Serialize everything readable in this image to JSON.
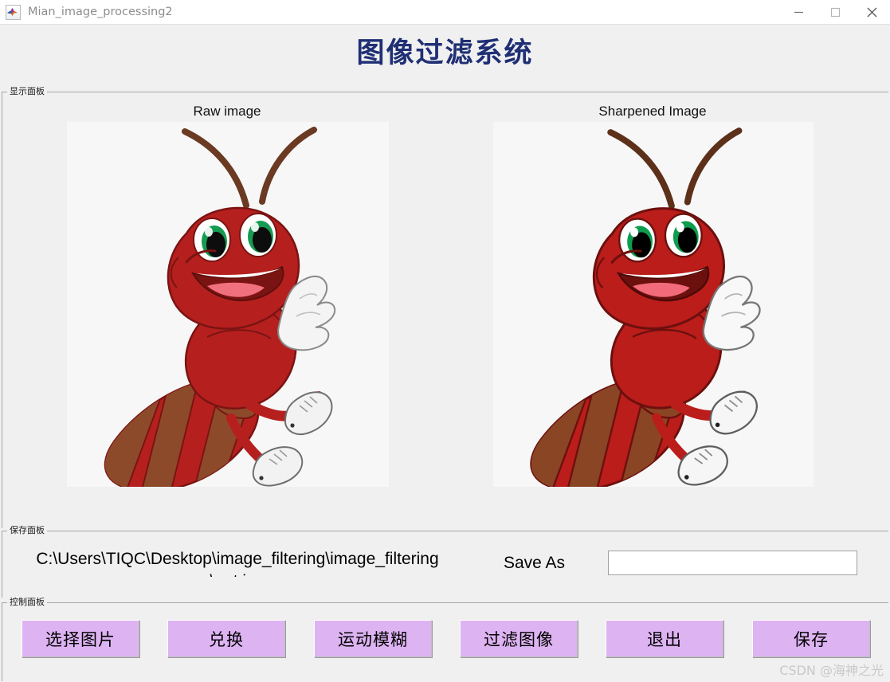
{
  "window": {
    "title": "Mian_image_processing2",
    "icon": "matlab-icon",
    "minimize": "—",
    "maximize": "□",
    "close": "✕"
  },
  "heading": "图像过滤系统",
  "display_panel": {
    "label": "显示面板",
    "axes": [
      {
        "title": "Raw image",
        "name": "raw-image"
      },
      {
        "title": "Sharpened Image",
        "name": "sharpened-image"
      }
    ]
  },
  "save_panel": {
    "label": "保存面板",
    "path": "C:\\Users\\TIQC\\Desktop\\image_filtering\\image_filtering\n\\ant.jpg",
    "save_as_label": "Save As",
    "save_as_value": "",
    "save_as_placeholder": ""
  },
  "control_panel": {
    "label": "控制面板",
    "buttons": [
      {
        "label": "选择图片",
        "name": "select-image-button"
      },
      {
        "label": "兑换",
        "name": "exchange-button"
      },
      {
        "label": "运动模糊",
        "name": "motion-blur-button"
      },
      {
        "label": "过滤图像",
        "name": "filter-image-button"
      },
      {
        "label": "退出",
        "name": "exit-button"
      },
      {
        "label": "保存",
        "name": "save-button"
      }
    ]
  },
  "watermark": "CSDN @海神之光",
  "colors": {
    "window_background": "#f0f0f0",
    "title_text": "#1f2f74",
    "button_face": "#ddb3f2",
    "panel_border": "#a6a6a6",
    "image_canvas": "#f7f7f7",
    "ant_body_red": "#b5201e",
    "ant_abdomen_brown": "#8d4a2a",
    "ant_antenna_brown": "#6b3a22",
    "ant_eye_green": "#159b52",
    "ant_tongue_pink": "#f0707e",
    "ant_glove_white": "#f4f4f4"
  }
}
